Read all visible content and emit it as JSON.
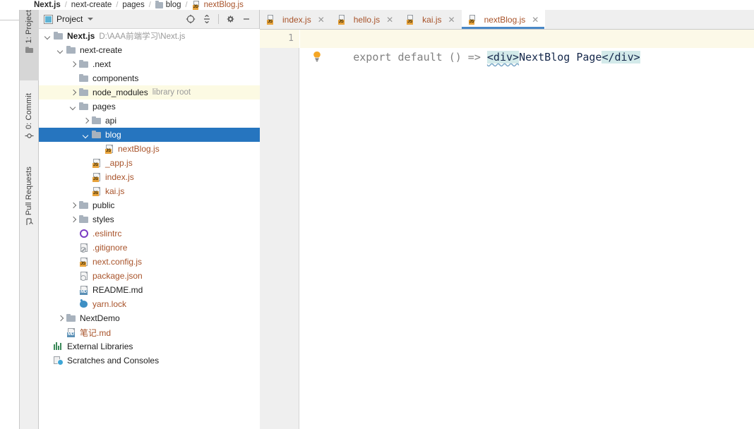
{
  "breadcrumb": {
    "items": [
      {
        "label": "Next.js",
        "type": "root"
      },
      {
        "label": "next-create",
        "type": "plain"
      },
      {
        "label": "pages",
        "type": "plain"
      },
      {
        "label": "blog",
        "type": "folder"
      },
      {
        "label": "nextBlog.js",
        "type": "js-file"
      }
    ],
    "separator": "/"
  },
  "tool_window_bar": {
    "buttons": [
      {
        "label": "1: Project",
        "icon": "project-folder-icon",
        "active": true
      },
      {
        "label": "0: Commit",
        "icon": "commit-icon",
        "active": false
      },
      {
        "label": "Pull Requests",
        "icon": "pull-request-icon",
        "active": false
      }
    ]
  },
  "project_panel": {
    "title": "Project",
    "title_icon": "project-view-icon",
    "dropdown_icon": "chevron-down-icon",
    "toolbar": [
      {
        "name": "select-opened-file-button",
        "icon": "crosshair-target-icon"
      },
      {
        "name": "collapse-all-button",
        "icon": "collapse-all-icon"
      },
      {
        "name": "settings-button",
        "icon": "gear-icon"
      },
      {
        "name": "hide-panel-button",
        "icon": "minimize-icon"
      }
    ],
    "tree": [
      {
        "label": "Next.js",
        "note": "D:\\AAA前端学习\\Next.js",
        "indent": 0,
        "arrow": "open",
        "icon": "folder",
        "style": "bold",
        "state": "normal"
      },
      {
        "label": "next-create",
        "note": "",
        "indent": 1,
        "arrow": "open",
        "icon": "folder",
        "style": "plain",
        "state": "normal"
      },
      {
        "label": ".next",
        "note": "",
        "indent": 2,
        "arrow": "closed",
        "icon": "folder",
        "style": "plain",
        "state": "normal"
      },
      {
        "label": "components",
        "note": "",
        "indent": 2,
        "arrow": "none",
        "icon": "folder",
        "style": "plain",
        "state": "normal"
      },
      {
        "label": "node_modules",
        "note": "library root",
        "indent": 2,
        "arrow": "closed",
        "icon": "folder",
        "style": "plain",
        "state": "highlight"
      },
      {
        "label": "pages",
        "note": "",
        "indent": 2,
        "arrow": "open",
        "icon": "folder",
        "style": "plain",
        "state": "normal"
      },
      {
        "label": "api",
        "note": "",
        "indent": 3,
        "arrow": "closed",
        "icon": "folder",
        "style": "plain",
        "state": "normal"
      },
      {
        "label": "blog",
        "note": "",
        "indent": 3,
        "arrow": "open",
        "icon": "folder",
        "style": "plain",
        "state": "selected"
      },
      {
        "label": "nextBlog.js",
        "note": "",
        "indent": 4,
        "arrow": "none",
        "icon": "js",
        "style": "js",
        "state": "normal"
      },
      {
        "label": "_app.js",
        "note": "",
        "indent": 3,
        "arrow": "none",
        "icon": "js",
        "style": "js",
        "state": "normal"
      },
      {
        "label": "index.js",
        "note": "",
        "indent": 3,
        "arrow": "none",
        "icon": "js",
        "style": "js",
        "state": "normal"
      },
      {
        "label": "kai.js",
        "note": "",
        "indent": 3,
        "arrow": "none",
        "icon": "js",
        "style": "js",
        "state": "normal"
      },
      {
        "label": "public",
        "note": "",
        "indent": 2,
        "arrow": "closed",
        "icon": "folder",
        "style": "plain",
        "state": "normal"
      },
      {
        "label": "styles",
        "note": "",
        "indent": 2,
        "arrow": "closed",
        "icon": "folder",
        "style": "plain",
        "state": "normal"
      },
      {
        "label": ".eslintrc",
        "note": "",
        "indent": 2,
        "arrow": "none",
        "icon": "eslint",
        "style": "js",
        "state": "normal"
      },
      {
        "label": ".gitignore",
        "note": "",
        "indent": 2,
        "arrow": "none",
        "icon": "gitignore",
        "style": "js",
        "state": "normal"
      },
      {
        "label": "next.config.js",
        "note": "",
        "indent": 2,
        "arrow": "none",
        "icon": "js",
        "style": "js",
        "state": "normal"
      },
      {
        "label": "package.json",
        "note": "",
        "indent": 2,
        "arrow": "none",
        "icon": "json",
        "style": "js",
        "state": "normal"
      },
      {
        "label": "README.md",
        "note": "",
        "indent": 2,
        "arrow": "none",
        "icon": "md",
        "style": "plain",
        "state": "normal"
      },
      {
        "label": "yarn.lock",
        "note": "",
        "indent": 2,
        "arrow": "none",
        "icon": "yarn",
        "style": "js",
        "state": "normal"
      },
      {
        "label": "NextDemo",
        "note": "",
        "indent": 1,
        "arrow": "closed",
        "icon": "folder",
        "style": "plain",
        "state": "normal"
      },
      {
        "label": "笔记.md",
        "note": "",
        "indent": 1,
        "arrow": "none",
        "icon": "md",
        "style": "js",
        "state": "normal"
      },
      {
        "label": "External Libraries",
        "note": "",
        "indent": 0,
        "arrow": "none",
        "icon": "libs",
        "style": "plain",
        "state": "normal"
      },
      {
        "label": "Scratches and Consoles",
        "note": "",
        "indent": 0,
        "arrow": "none",
        "icon": "scratch",
        "style": "plain",
        "state": "normal"
      }
    ]
  },
  "editor": {
    "tabs": [
      {
        "label": "index.js",
        "icon": "js-file-icon",
        "active": false,
        "close_icon": "✕"
      },
      {
        "label": "hello.js",
        "icon": "js-file-icon",
        "active": false,
        "close_icon": "✕"
      },
      {
        "label": "kai.js",
        "icon": "js-file-icon",
        "active": false,
        "close_icon": "✕"
      },
      {
        "label": "nextBlog.js",
        "icon": "js-file-icon",
        "active": true,
        "close_icon": "✕"
      }
    ],
    "line_number": "1",
    "code": {
      "prefix": "export default () => ",
      "open_tag": "<div>",
      "text": "NextBlog Page",
      "close_tag": "</div>"
    },
    "intention_bulb": "lightbulb-icon"
  },
  "colors": {
    "selection_blue": "#2675bf",
    "tab_underline": "#4a88c7",
    "js_orange": "#a8532a",
    "tag_highlight": "#d3eaea",
    "current_line": "#fcf9e8",
    "node_modules_highlight": "#fcfae3",
    "panel_gray": "#efefef"
  }
}
